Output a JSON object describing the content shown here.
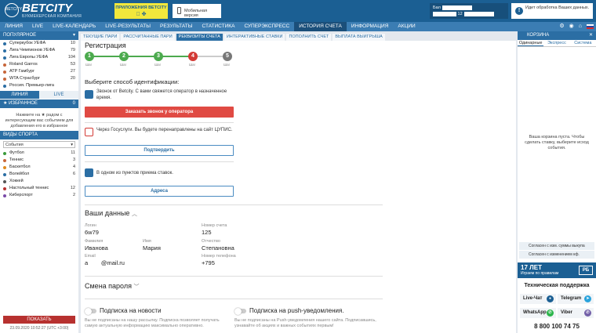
{
  "header": {
    "logo_mark": "BETCITY",
    "logo_text": "BETCITY",
    "logo_sub": "БУКМЕКЕРСКАЯ КОМПАНИЯ",
    "apps_label": "ПРИЛОЖЕНИЯ BETCITY",
    "apps_icons": " ✤",
    "mobile_label": "Мобильная версия",
    "balance_label": "Бал",
    "balance_value": "12",
    "notice": "Идет обработка Ваших данных."
  },
  "nav": {
    "items": [
      "ЛИНИЯ",
      "LIVE",
      "LIVE-КАЛЕНДАРЬ",
      "LIVE-РЕЗУЛЬТАТЫ",
      "РЕЗУЛЬТАТЫ",
      "СТАТИСТИКА",
      "СУПЕРЭКСПРЕСС",
      "ИСТОРИЯ СЧЕТА",
      "ИНФОРМАЦИЯ",
      "АКЦИИ"
    ],
    "active_index": 7,
    "icons": [
      "⚙",
      "◉",
      "⌂"
    ]
  },
  "left": {
    "popular_title": "ПОПУЛЯРНОЕ",
    "popular": [
      {
        "name": "Суперкубок УЕФА",
        "count": "10",
        "color": "#2b6ea4"
      },
      {
        "name": "Лига Чемпионов УЕФА",
        "count": "79",
        "color": "#2b6ea4"
      },
      {
        "name": "Лига Европы УЕФА",
        "count": "104",
        "color": "#2b6ea4"
      },
      {
        "name": "Roland Garros",
        "count": "53",
        "color": "#c7663a"
      },
      {
        "name": "ATP Гамбург",
        "count": "27",
        "color": "#c7663a"
      },
      {
        "name": "WTA Страсбург",
        "count": "20",
        "color": "#c7663a"
      },
      {
        "name": "Россия. Премьер-лига",
        "count": "",
        "color": "#2b6ea4"
      }
    ],
    "tab_line": "ЛИНИЯ",
    "tab_live": "LIVE",
    "favorites_title": "ИЗБРАННОЕ",
    "favorites_count": "0",
    "favorites_text": "Нажмите на ★ радом с интересующим вас событием для добавления его в избранное",
    "sports_title": "ВИДЫ СПОРТА",
    "select_value": "События",
    "sports": [
      {
        "name": "Футбол",
        "count": "11",
        "color": "#3a9a3a"
      },
      {
        "name": "Теннис",
        "count": "3",
        "color": "#c7663a"
      },
      {
        "name": "Баскетбол",
        "count": "4",
        "color": "#e08a1e"
      },
      {
        "name": "Волейбол",
        "count": "6",
        "color": "#2b6ea4"
      },
      {
        "name": "Хоккей",
        "count": "",
        "color": "#555555"
      },
      {
        "name": "Настольный теннис",
        "count": "12",
        "color": "#b7312f"
      },
      {
        "name": "Киберспорт",
        "count": "2",
        "color": "#7a4aa8"
      }
    ],
    "show_button": "ПОКАЗАТЬ",
    "timestamp": "23.09.2020 10:52:27 (UTC +3:00)"
  },
  "subtabs": {
    "items": [
      "ТЕКУЩИЕ ПАРИ",
      "РАССЧИТАННЫЕ ПАРИ",
      "РЕКВИЗИТЫ СЧЕТА",
      "ИНТЕРАКТИВНЫЕ СТАВКИ",
      "ПОПОЛНИТЬ СЧЕТ",
      "ВЫПЛАТА ВЫИГРЫША"
    ],
    "active_index": 2
  },
  "registration": {
    "title": "Регистрация",
    "steps": [
      {
        "num": "1",
        "label": "Шаг",
        "color": "#4caa4e"
      },
      {
        "num": "2",
        "label": "Шаг",
        "color": "#4caa4e"
      },
      {
        "num": "3",
        "label": "Шаг",
        "color": "#4caa4e"
      },
      {
        "num": "4",
        "label": "Шаг",
        "color": "#d33a35"
      },
      {
        "num": "5",
        "label": "Шаг",
        "color": "#777777"
      }
    ],
    "question": "Выберите способ идентификации:",
    "opt1_text": "Звонок от Betcity. С вами свяжется оператор в назначенное время.",
    "opt1_button": "Заказать звонок у оператора",
    "opt2_text": "Через Госуслуги. Вы будете перенаправлены на сайт ЦУПИС.",
    "opt2_button": "Подтвердить",
    "opt3_text": "В одном из пунктов приема ставок.",
    "opt3_button": "Адреса"
  },
  "data_section": {
    "title": "Ваши данные",
    "chevron": "︿",
    "login_label": "Логин",
    "login_value": "6w79",
    "account_label": "Номер счета",
    "account_value": "125",
    "surname_label": "Фамилия",
    "surname_value": "Иванова",
    "name_label": "Имя",
    "name_value": "Мария",
    "patronymic_label": "Отчество",
    "patronymic_value": "Степановна",
    "email_label": "Email",
    "email_value": "а        @mail.ru",
    "phone_label": "Номер телефона",
    "phone_value": "+795"
  },
  "password": {
    "title": "Смена пароля",
    "chevron": "﹀"
  },
  "subscriptions": {
    "news_title": "Подписка на новости",
    "news_desc": "Вы не подписаны на нашу рассылку. Подписка позволяет получать самую актуальную информацию максимально оперативно.",
    "push_title": "Подписка на push-уведомления.",
    "push_desc": "Вы не подписаны на Push-уведомления нашего сайта. Подписавшись, узнавайте об акциях и важных событиях первым!"
  },
  "cart": {
    "title": "КОРЗИНА",
    "tabs": [
      "Одинарные",
      "Экспресс",
      "Система"
    ],
    "empty_text": "Ваша корзина пуста. Чтобы сделать ставку, выберите исход события.",
    "check1": "Согласен с изм. суммы выкупа",
    "check2": "Согласен с изменением кф."
  },
  "promo": {
    "age": "17 ЛЕТ",
    "tagline": "Играем по правилам",
    "badge": "РБ"
  },
  "support": {
    "title": "Техническая поддержка",
    "live_chat": "Live-Чат",
    "telegram": "Telegram",
    "whatsapp": "WhatsApp",
    "viber": "Viber",
    "phone": "8 800 100 74 75"
  }
}
